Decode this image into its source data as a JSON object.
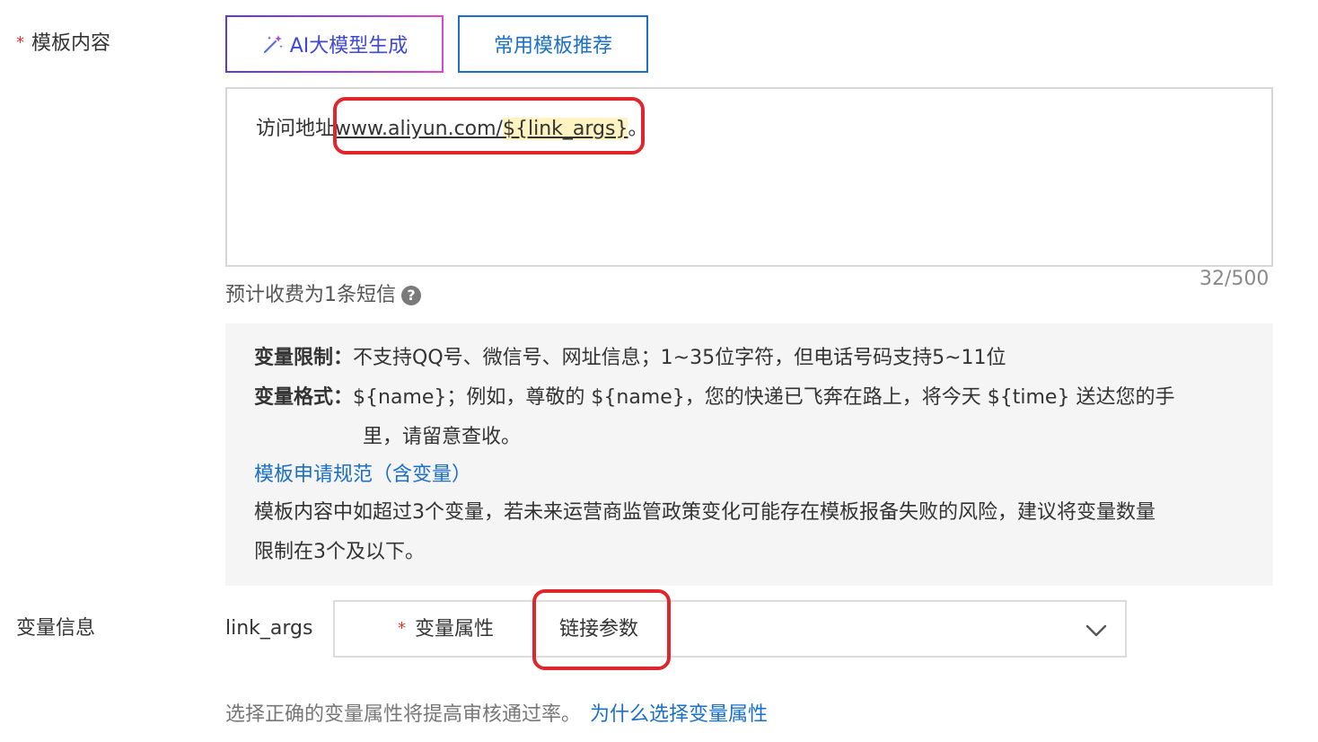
{
  "template_content": {
    "label": "模板内容",
    "required_mark": "*",
    "ai_button_label": "AI大模型生成",
    "common_button_label": "常用模板推荐",
    "text_prefix": "访问地址",
    "text_link": "www.aliyun.com/",
    "text_variable": "${link_args}",
    "text_suffix": "。",
    "counter": "32/500",
    "estimate": "预计收费为1条短信",
    "help_glyph": "?"
  },
  "info_panel": {
    "limit_title": "变量限制：",
    "limit_text": "不支持QQ号、微信号、网址信息；1~35位字符，但电话号码支持5~11位",
    "format_title": "变量格式：",
    "format_text_line1": "${name}；例如，尊敬的 ${name}，您的快递已飞奔在路上，将今天 ${time} 送达您的手",
    "format_text_line2": "里，请留意查收。",
    "spec_link": "模板申请规范（含变量）",
    "warning_line1": "模板内容中如超过3个变量，若未来运营商监管政策变化可能存在模板报备失败的风险，建议将变量数量",
    "warning_line2": "限制在3个及以下。"
  },
  "variable_info": {
    "label": "变量信息",
    "variable_name": "link_args",
    "attribute_label": "变量属性",
    "required_mark": "*",
    "attribute_value": "链接参数",
    "helper_text": "选择正确的变量属性将提高审核通过率。",
    "helper_link": "为什么选择变量属性"
  },
  "colors": {
    "primary_blue": "#1a6fc9",
    "ai_text": "#3f47d8",
    "required_red": "#e0362f",
    "annotation_red": "#e0262c",
    "panel_bg": "#f5f5f5"
  }
}
